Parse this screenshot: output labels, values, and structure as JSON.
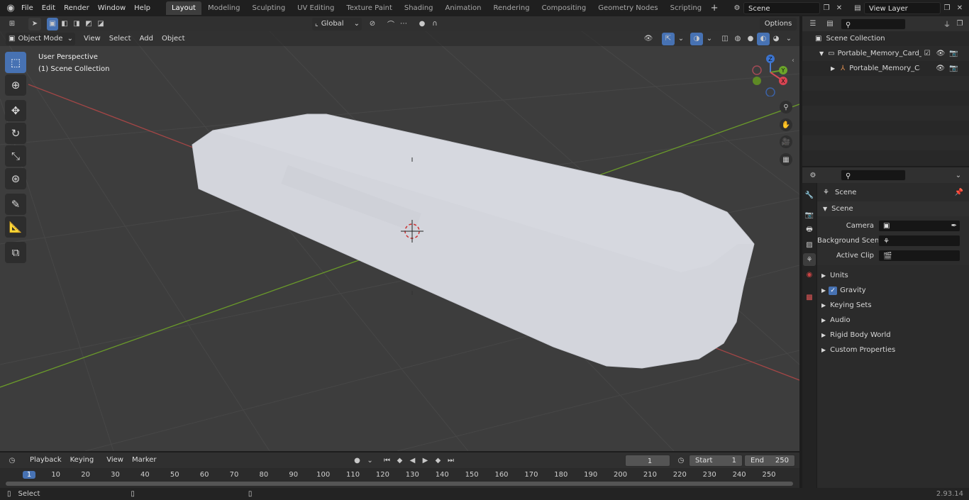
{
  "menu": {
    "file": "File",
    "edit": "Edit",
    "render": "Render",
    "window": "Window",
    "help": "Help"
  },
  "workspaces": [
    "Layout",
    "Modeling",
    "Sculpting",
    "UV Editing",
    "Texture Paint",
    "Shading",
    "Animation",
    "Rendering",
    "Compositing",
    "Geometry Nodes",
    "Scripting"
  ],
  "active_workspace": "Layout",
  "scene_field": "Scene",
  "view_layer_field": "View Layer",
  "viewport_header": {
    "mode": "Object Mode",
    "view": "View",
    "select": "Select",
    "add": "Add",
    "object": "Object",
    "transform": "Global",
    "options": "Options"
  },
  "overlay_text": {
    "perspective": "User Perspective",
    "collection": "(1) Scene Collection"
  },
  "gizmo": {
    "z": "Z",
    "y": "Y",
    "x": "X"
  },
  "outliner": {
    "search_placeholder": "",
    "scene_collection": "Scene Collection",
    "item1": "Portable_Memory_Card_Reac",
    "item2": "Portable_Memory_Card_I"
  },
  "properties": {
    "header": "Scene",
    "section": "Scene",
    "camera_label": "Camera",
    "background_label": "Background Scene",
    "clip_label": "Active Clip",
    "subpanels": [
      "Units",
      "Gravity",
      "Keying Sets",
      "Audio",
      "Rigid Body World",
      "Custom Properties"
    ]
  },
  "timeline": {
    "playback": "Playback",
    "keying": "Keying",
    "view": "View",
    "marker": "Marker",
    "current_frame": "1",
    "start_label": "Start",
    "start_value": "1",
    "end_label": "End",
    "end_value": "250",
    "ticks": [
      "1",
      "10",
      "20",
      "30",
      "40",
      "50",
      "60",
      "70",
      "80",
      "90",
      "100",
      "110",
      "120",
      "130",
      "140",
      "150",
      "160",
      "170",
      "180",
      "190",
      "200",
      "210",
      "220",
      "230",
      "240",
      "250"
    ]
  },
  "status": {
    "select": "Select",
    "version": "2.93.14"
  },
  "colors": {
    "accent": "#4772b3",
    "x_axis": "#b34a4a",
    "y_axis": "#6b9b2a",
    "object": "#d4d6dc"
  }
}
